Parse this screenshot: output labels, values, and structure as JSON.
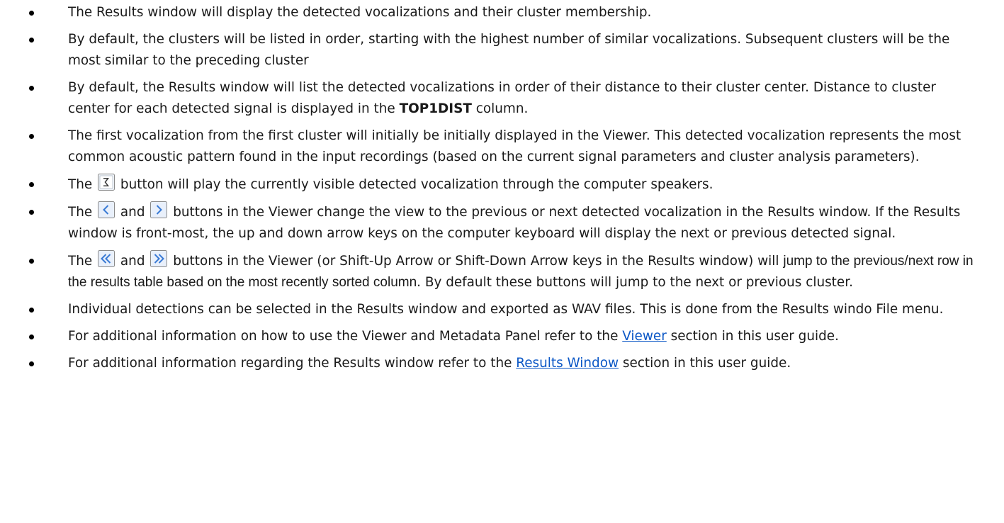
{
  "bullets": [
    {
      "text": "The Results window will display the detected vocalizations and their cluster membership."
    },
    {
      "text": "By default, the clusters will be listed in order, starting with the highest number of similar vocalizations. Subsequent clusters will be the most similar to the preceding cluster"
    },
    {
      "before": "By default, the Results window will list the detected vocalizations in order of their distance to their cluster center. Distance to cluster center for each detected signal is displayed in the ",
      "bold": "TOP1DIST",
      "after": " column."
    },
    {
      "text": "The first vocalization from the first cluster will initially be initially displayed in the Viewer. This detected vocalization represents the most common acoustic pattern found in the input recordings (based on the current signal parameters and cluster analysis parameters)."
    },
    {
      "before": "The ",
      "icon1": "play-button-icon",
      "after": " button will play the currently visible detected vocalization through the computer speakers."
    },
    {
      "before": "The ",
      "icon1": "previous-button-icon",
      "mid": " and ",
      "icon2": "next-button-icon",
      "after": " buttons in the Viewer change the view to the previous or next detected vocalization in the Results window. If the Results window is front-most, the up and down arrow keys on the computer keyboard will display the next or previous detected signal."
    },
    {
      "before": "The ",
      "icon1": "jump-previous-button-icon",
      "mid": " and ",
      "icon2": "jump-next-button-icon",
      "after_a": " buttons in the Viewer (or Shift-Up Arrow or Shift-Down Arrow keys in the Results window) will ",
      "after_b": "jump to the previous/next row in the results table based on the most recently sorted column",
      "after_c": ". By default these buttons will jump to the next or previous cluster."
    },
    {
      "text": "Individual detections can be selected in the Results window and exported as WAV files.  This is done from the Results windo File menu."
    },
    {
      "before": "For additional information on how to use the Viewer and Metadata Panel refer to the ",
      "link": "Viewer",
      "after": " section in this user guide."
    },
    {
      "before": "For additional information regarding the Results window refer to the ",
      "link": "Results Window",
      "after": " section in this user guide."
    }
  ],
  "colors": {
    "text": "#1a1a1a",
    "link": "#0b57c6",
    "icon_border": "#8a8a8a",
    "icon_fill": "#e9f0fb",
    "icon_glyph": "#3a7bd5"
  }
}
